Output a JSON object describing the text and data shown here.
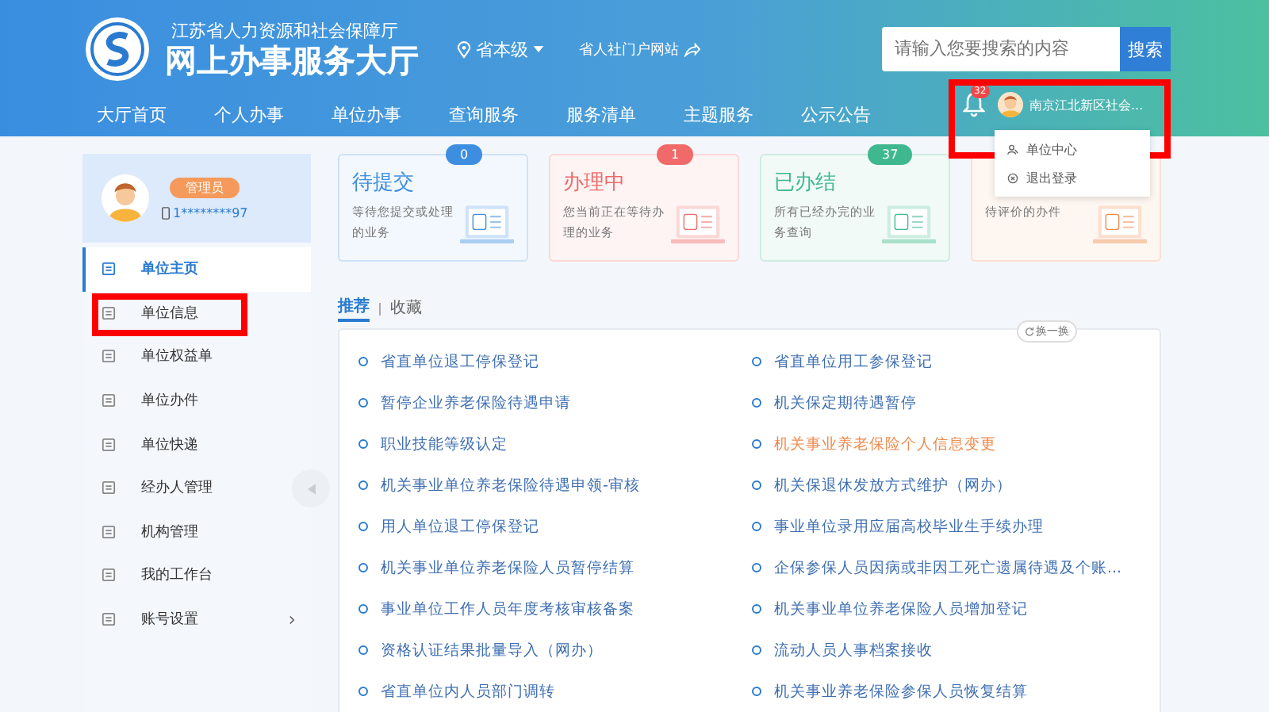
{
  "header": {
    "org": "江苏省人力资源和社会保障厅",
    "title": "网上办事服务大厅",
    "region": "省本级",
    "portal_link": "省人社门户网站",
    "search": {
      "placeholder": "请输入您要搜索的内容",
      "button": "搜索"
    }
  },
  "nav": [
    {
      "label": "大厅首页"
    },
    {
      "label": "个人办事"
    },
    {
      "label": "单位办事"
    },
    {
      "label": "查询服务"
    },
    {
      "label": "服务清单"
    },
    {
      "label": "主题服务"
    },
    {
      "label": "公示公告"
    }
  ],
  "user_menu": {
    "notification_count": "32",
    "name": "南京江北新区社会...",
    "highlighted": true,
    "items": [
      {
        "label": "单位中心"
      },
      {
        "label": "退出登录"
      }
    ]
  },
  "profile": {
    "role": "管理员",
    "phone": "1********97"
  },
  "sidebar": {
    "items": [
      {
        "label": "单位主页",
        "selected": true,
        "highlighted": false,
        "expandable": false
      },
      {
        "label": "单位信息",
        "selected": false,
        "highlighted": true,
        "expandable": false
      },
      {
        "label": "单位权益单",
        "selected": false,
        "highlighted": false,
        "expandable": false
      },
      {
        "label": "单位办件",
        "selected": false,
        "highlighted": false,
        "expandable": false
      },
      {
        "label": "单位快递",
        "selected": false,
        "highlighted": false,
        "expandable": false
      },
      {
        "label": "经办人管理",
        "selected": false,
        "highlighted": false,
        "expandable": false
      },
      {
        "label": "机构管理",
        "selected": false,
        "highlighted": false,
        "expandable": false
      },
      {
        "label": "我的工作台",
        "selected": false,
        "highlighted": false,
        "expandable": false
      },
      {
        "label": "账号设置",
        "selected": false,
        "highlighted": false,
        "expandable": true
      }
    ]
  },
  "cards": [
    {
      "kind": "pending",
      "title": "待提交",
      "count": "0",
      "description": "等待您提交或处理的业务"
    },
    {
      "kind": "processing",
      "title": "办理中",
      "count": "1",
      "description": "您当前正在等待办理的业务"
    },
    {
      "kind": "done",
      "title": "已办结",
      "count": "37",
      "description": "所有已经办完的业务查询"
    },
    {
      "kind": "review",
      "description": "待评价的办件"
    }
  ],
  "tabs": [
    {
      "label": "推荐",
      "selected": true
    },
    {
      "label": "收藏",
      "selected": false
    }
  ],
  "refresh_button": "换一换",
  "services": [
    {
      "label": "省直单位退工停保登记",
      "highlighted": false
    },
    {
      "label": "省直单位用工参保登记",
      "highlighted": false
    },
    {
      "label": "暂停企业养老保险待遇申请",
      "highlighted": false
    },
    {
      "label": "机关保定期待遇暂停",
      "highlighted": false
    },
    {
      "label": "职业技能等级认定",
      "highlighted": false
    },
    {
      "label": "机关事业养老保险个人信息变更",
      "highlighted": true
    },
    {
      "label": "机关事业单位养老保险待遇申领-审核",
      "highlighted": false
    },
    {
      "label": "机关保退休发放方式维护（网办）",
      "highlighted": false
    },
    {
      "label": "用人单位退工停保登记",
      "highlighted": false
    },
    {
      "label": "事业单位录用应届高校毕业生手续办理",
      "highlighted": false
    },
    {
      "label": "机关事业单位养老保险人员暂停结算",
      "highlighted": false
    },
    {
      "label": "企保参保人员因病或非因工死亡遗属待遇及个账...",
      "highlighted": false
    },
    {
      "label": "事业单位工作人员年度考核审核备案",
      "highlighted": false
    },
    {
      "label": "机关事业单位养老保险人员增加登记",
      "highlighted": false
    },
    {
      "label": "资格认证结果批量导入（网办）",
      "highlighted": false
    },
    {
      "label": "流动人员人事档案接收",
      "highlighted": false
    },
    {
      "label": "省直单位内人员部门调转",
      "highlighted": false
    },
    {
      "label": "机关事业养老保险参保人员恢复结算",
      "highlighted": false
    }
  ]
}
